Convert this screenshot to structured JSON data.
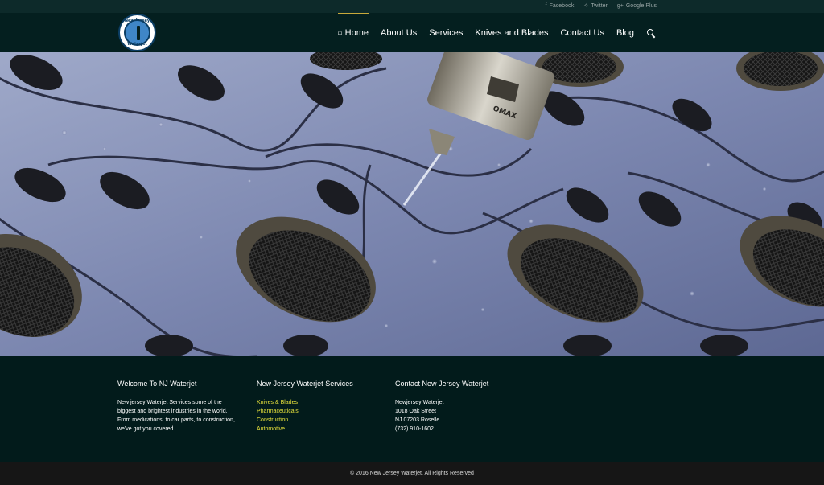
{
  "social": [
    {
      "icon": "facebook-icon",
      "glyph": "f",
      "label": "Facebook"
    },
    {
      "icon": "twitter-icon",
      "glyph": "✧",
      "label": "Twitter"
    },
    {
      "icon": "google-plus-icon",
      "glyph": "g+",
      "label": "Google Plus"
    }
  ],
  "logo": {
    "top": "New Jersey",
    "bottom": "Waterjet"
  },
  "nav": [
    {
      "label": "Home",
      "active": true
    },
    {
      "label": "About Us"
    },
    {
      "label": "Services"
    },
    {
      "label": "Knives and Blades"
    },
    {
      "label": "Contact Us"
    },
    {
      "label": "Blog"
    }
  ],
  "hero": {
    "nozzle_brand": "OMAX"
  },
  "footer": {
    "welcome": {
      "title": "Welcome To NJ Waterjet",
      "lines": [
        "New jersey Waterjet Services some of the",
        "biggest and brightest industries in the world.",
        "From medications, to car parts, to construction,",
        "we've got you covered."
      ]
    },
    "services": {
      "title": "New Jersey Waterjet Services",
      "links": [
        "Knives & Blades",
        "Pharmaceuticals",
        "Construction",
        "Automotive"
      ]
    },
    "contact": {
      "title": "Contact New Jersey Waterjet",
      "lines": [
        "Newjersey Waterjet",
        "1018 Oak Street",
        "NJ 07203 Roselle",
        "(732) 910-1602"
      ]
    }
  },
  "copyright": "© 2016 New Jersey Waterjet. All Rights Reserved",
  "colors": {
    "accent": "#c8a93a",
    "link": "#e7e13b",
    "background": "#021b1b"
  }
}
